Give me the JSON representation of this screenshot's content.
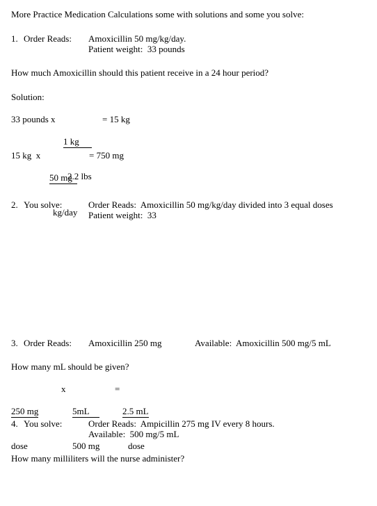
{
  "document": {
    "title_line": "More Practice Medication Calculations some with solutions and some you solve:",
    "problems": [
      {
        "number": "1.",
        "label": "Order Reads:",
        "lines": [
          "Amoxicillin 50 mg/kg/day.",
          "Patient weight:  33 pounds"
        ],
        "question": "How much Amoxicillin should this patient receive in a 24 hour period?",
        "solution_heading": "Solution:",
        "solution_steps": [
          {
            "lead": "33 pounds x ",
            "numerator": "1 kg",
            "denominator": "2.2 lbs",
            "result": "= 15 kg"
          },
          {
            "lead": "15 kg  x ",
            "numerator": "50 mg",
            "denominator": "kg/day",
            "result": "= 750 mg"
          }
        ]
      },
      {
        "number": "2.",
        "label": "You solve:",
        "lines": [
          "Order Reads:  Amoxicillin 50 mg/kg/day divided into 3 equal doses",
          "Patient weight:  33"
        ]
      },
      {
        "number": "3.",
        "label": "Order Reads:",
        "order_text": "Amoxicillin 250 mg",
        "available_text": "Available:  Amoxicillin 500 mg/5 mL",
        "question": "How many mL should be given?",
        "work": {
          "f1_num": "250 mg",
          "f1_den": "dose",
          "operator": "x",
          "f2_num": "5mL",
          "f2_den": "500 mg",
          "equals": "=",
          "f3_num": "2.5 mL",
          "f3_den": "dose"
        }
      },
      {
        "number": "4.",
        "label": "You solve:",
        "lines": [
          "Order Reads:  Ampicillin 275 mg IV every 8 hours.",
          "Available:  500 mg/5 mL"
        ],
        "question": "How many milliliters will the nurse administer?"
      }
    ]
  }
}
